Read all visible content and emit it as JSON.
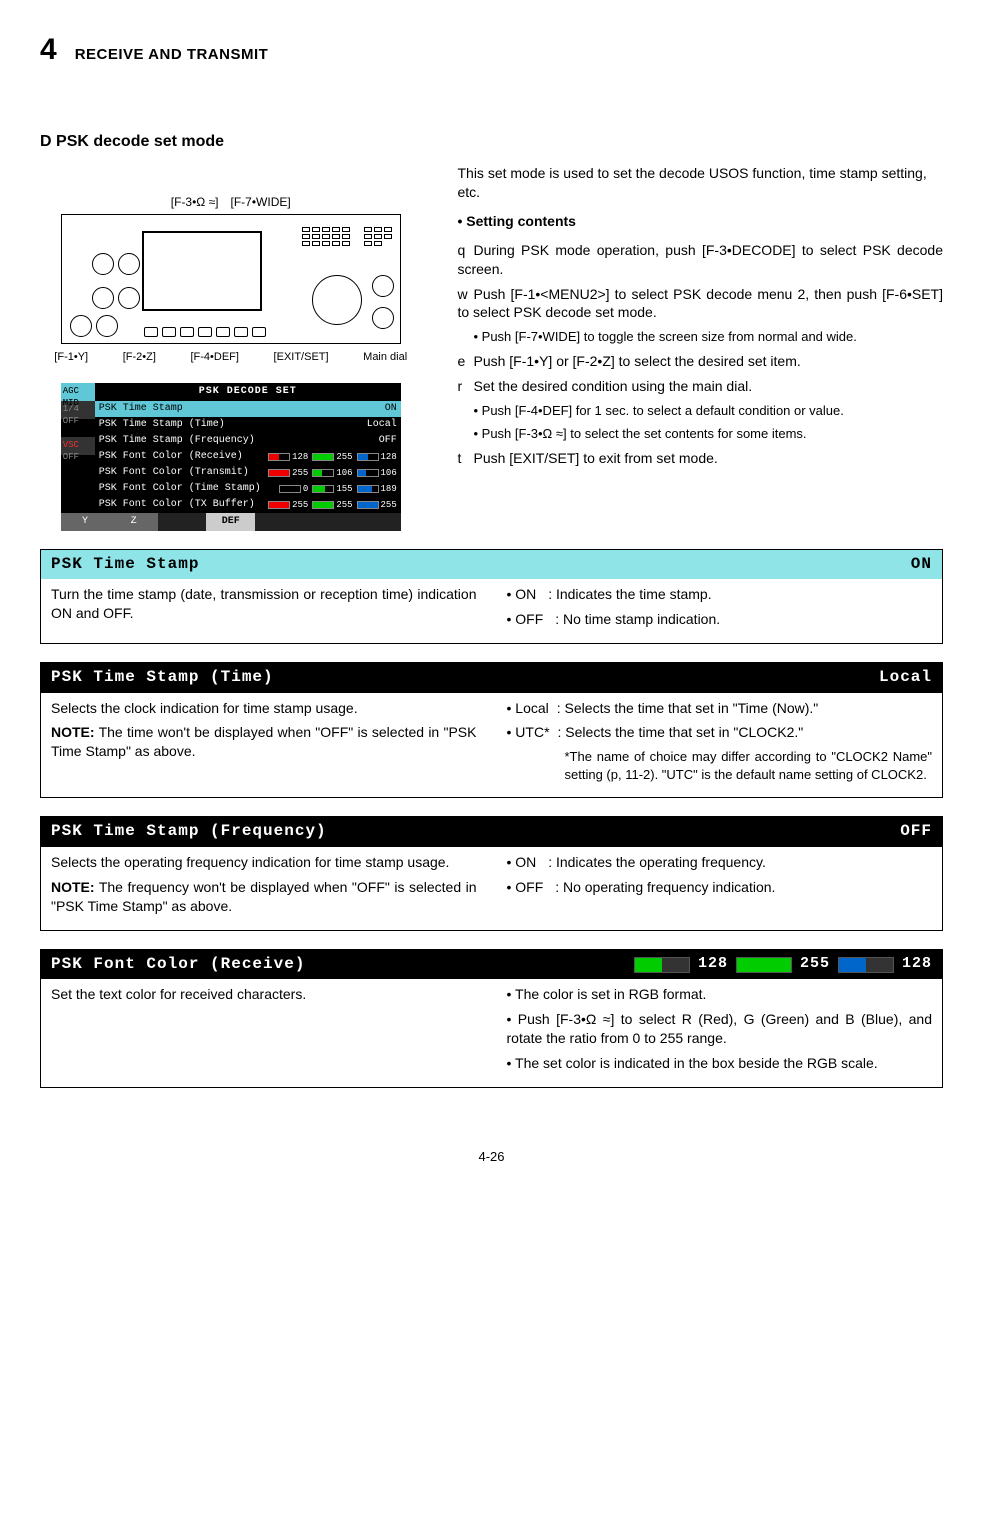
{
  "chapter": {
    "number": "4",
    "title": "RECEIVE AND TRANSMIT"
  },
  "section": {
    "diamond": "D",
    "title": "PSK decode set mode"
  },
  "diagram": {
    "top_labels": [
      "[F-3•Ω ≈]",
      "[F-7•WIDE]"
    ],
    "bottom_labels": [
      "[F-1•Y]",
      "[F-2•Z]",
      "[F-4•DEF]",
      "[EXIT/SET]",
      "Main dial"
    ]
  },
  "setshot": {
    "title": "PSK DECODE SET",
    "side": {
      "agc_top": "AGC",
      "agc_mid": "MID",
      "q": "1/4",
      "off1": "OFF",
      "vsc": "VSC",
      "off2": "OFF"
    },
    "rows": [
      {
        "label": "PSK Time Stamp",
        "value_text": "ON",
        "hl": true
      },
      {
        "label": "PSK Time Stamp (Time)",
        "value_text": "Local"
      },
      {
        "label": "PSK Time Stamp (Frequency)",
        "value_text": "OFF"
      },
      {
        "label": "PSK Font Color (Receive)",
        "rgb": [
          128,
          255,
          128
        ]
      },
      {
        "label": "PSK Font Color (Transmit)",
        "rgb": [
          255,
          106,
          106
        ]
      },
      {
        "label": "PSK Font Color (Time Stamp)",
        "rgb": [
          0,
          155,
          189
        ]
      },
      {
        "label": "PSK Font Color (TX Buffer)",
        "rgb": [
          255,
          255,
          255
        ]
      }
    ],
    "footer": [
      "Y",
      "Z",
      "",
      "DEF",
      "",
      "",
      ""
    ]
  },
  "intro": {
    "line1": "This set mode is used to set the decode USOS function, time stamp setting, etc.",
    "subhead": "• Setting contents",
    "step1": "During PSK mode operation, push [F-3•DECODE] to select PSK decode screen.",
    "step2": "Push [F-1•<MENU2>] to select PSK decode menu 2, then push [F-6•SET] to select PSK decode set mode.",
    "step2a": "• Push [F-7•WIDE] to toggle the screen size from normal and wide.",
    "step3": "Push [F-1•Y] or [F-2•Z] to select the desired set item.",
    "step4": "Set the desired condition using the main dial.",
    "step4a": "• Push [F-4•DEF] for 1 sec. to select a default condition or value.",
    "step4b": "• Push [F-3•Ω ≈] to select the set contents for some items.",
    "step5": "Push [EXIT/SET] to exit from set mode.",
    "nums": {
      "n1": "q",
      "n2": "w",
      "n3": "e",
      "n4": "r",
      "n5": "t"
    }
  },
  "cards": {
    "timestamp": {
      "bar_label": "PSK  Time  Stamp",
      "bar_value": "ON",
      "left": "Turn the time stamp (date, transmission or reception time) indication ON and OFF.",
      "r1k": "• ON",
      "r1v": ": Indicates the time stamp.",
      "r2k": "• OFF",
      "r2v": ": No time stamp indication."
    },
    "time": {
      "bar_label": "PSK  Time  Stamp  (Time)",
      "bar_value": "Local",
      "left1": "Selects the clock indication for time stamp usage.",
      "note_label": "NOTE:",
      "note_text": "The time won't be displayed when \"OFF\" is selected in \"PSK Time Stamp\" as above.",
      "r1k": "• Local",
      "r1v": ": Selects the time that set in \"Time (Now).\"",
      "r2k": "• UTC*",
      "r2v": ": Selects the time that set in \"CLOCK2.\"",
      "small": "*The name of choice may differ according to \"CLOCK2 Name\" setting (p, 11-2). \"UTC\" is the default name setting of CLOCK2."
    },
    "freq": {
      "bar_label": "PSK  Time  Stamp  (Frequency)",
      "bar_value": "OFF",
      "left1": "Selects the operating frequency indication for time stamp usage.",
      "note_label": "NOTE:",
      "note_text": "The frequency won't be displayed when \"OFF\" is selected in \"PSK Time Stamp\" as above.",
      "r1k": "• ON",
      "r1v": ": Indicates the operating frequency.",
      "r2k": "• OFF",
      "r2v": ": No operating frequency indication."
    },
    "color": {
      "bar_label": "PSK  Font  Color  (Receive)",
      "rgb": {
        "r": 128,
        "g": 255,
        "b": 128
      },
      "left": "Set the text color for received characters.",
      "r1": "• The color is set in RGB format.",
      "r2": "• Push [F-3•Ω ≈] to select R (Red), G (Green) and B (Blue), and rotate the ratio from 0 to 255 range.",
      "r3": "• The set color is indicated in the box beside the RGB scale."
    }
  },
  "page_number": "4-26"
}
